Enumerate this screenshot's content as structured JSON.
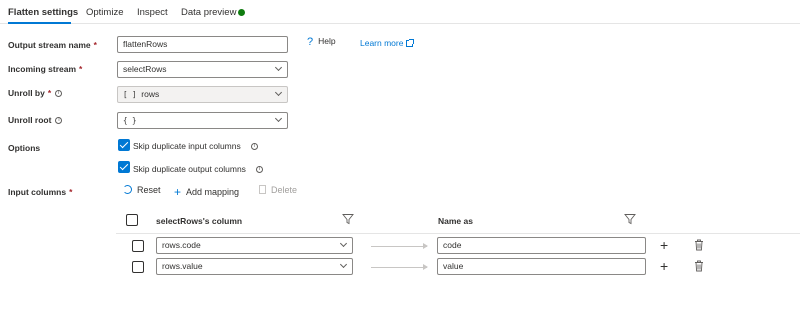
{
  "tabs": [
    {
      "label": "Flatten settings"
    },
    {
      "label": "Optimize"
    },
    {
      "label": "Inspect"
    },
    {
      "label": "Data preview"
    }
  ],
  "form": {
    "output_stream_name": {
      "label": "Output stream name",
      "required": "*",
      "value": "flattenRows"
    },
    "incoming_stream": {
      "label": "Incoming stream",
      "required": "*",
      "value": "selectRows"
    },
    "unroll_by": {
      "label": "Unroll by",
      "required": "*",
      "value_icon": "[ ]",
      "value": "rows"
    },
    "unroll_root": {
      "label": "Unroll root",
      "value_icon": "{ }"
    },
    "options": {
      "label": "Options",
      "skip_input": {
        "label": "Skip duplicate input columns",
        "checked": true
      },
      "skip_output": {
        "label": "Skip duplicate output columns",
        "checked": true
      }
    },
    "input_columns": {
      "label": "Input columns",
      "required": "*"
    }
  },
  "help": {
    "label": "Help",
    "learn_more": "Learn more"
  },
  "toolbar": {
    "reset": "Reset",
    "add_mapping": "Add mapping",
    "delete": "Delete"
  },
  "mapping_table": {
    "headers": {
      "column": "selectRows's column",
      "name_as": "Name as"
    },
    "rows": [
      {
        "column": "rows.code",
        "name_as": "code"
      },
      {
        "column": "rows.value",
        "name_as": "value"
      }
    ]
  },
  "colors": {
    "accent": "#0078d4",
    "status_ok": "#107c10"
  },
  "icons": [
    "help-icon",
    "external-link-icon",
    "info-icon",
    "reset-icon",
    "plus-icon",
    "trash-icon",
    "filter-icon",
    "chevron-down-icon"
  ]
}
